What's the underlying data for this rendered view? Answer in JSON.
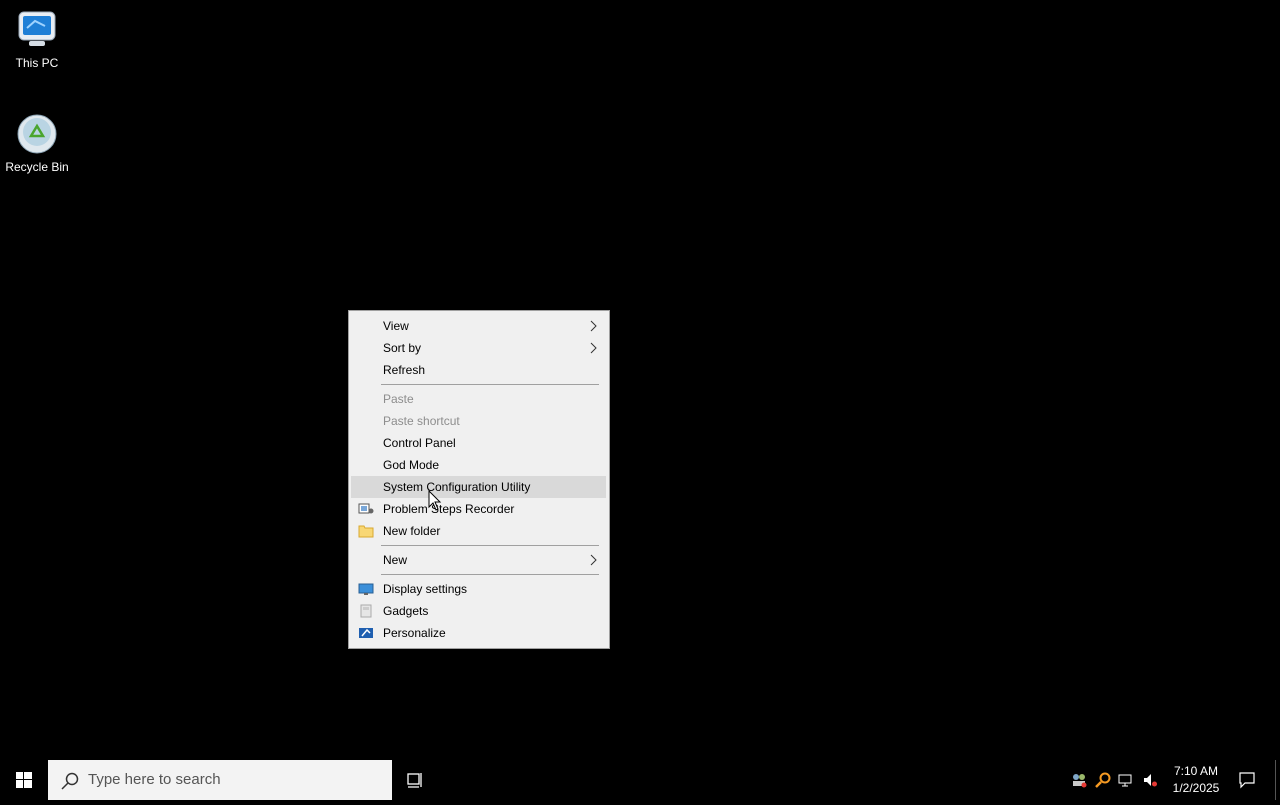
{
  "desktop": {
    "icons": [
      {
        "label": "This PC",
        "icon": "monitor-icon"
      },
      {
        "label": "Recycle Bin",
        "icon": "recycle-bin-icon"
      }
    ]
  },
  "context_menu": {
    "items": [
      {
        "label": "View",
        "submenu": true
      },
      {
        "label": "Sort by",
        "submenu": true
      },
      {
        "label": "Refresh"
      },
      {
        "label": "Paste",
        "disabled": true
      },
      {
        "label": "Paste shortcut",
        "disabled": true
      },
      {
        "label": "Control Panel"
      },
      {
        "label": "God Mode"
      },
      {
        "label": "System Configuration Utility",
        "highlighted": true
      },
      {
        "label": "Problem Steps Recorder",
        "icon": "steps-recorder-icon"
      },
      {
        "label": "New folder",
        "icon": "folder-icon"
      },
      {
        "label": "New",
        "submenu": true
      },
      {
        "label": "Display settings",
        "icon": "display-icon"
      },
      {
        "label": "Gadgets",
        "icon": "gadgets-icon"
      },
      {
        "label": "Personalize",
        "icon": "personalize-icon"
      }
    ]
  },
  "taskbar": {
    "search_placeholder": "Type here to search",
    "clock": {
      "time": "7:10 AM",
      "date": "1/2/2025"
    }
  },
  "colors": {
    "desktop_bg": "#000000",
    "menu_bg": "#f0f0f0",
    "menu_highlight": "#d9d9d9",
    "disabled_text": "#8d8d8d"
  }
}
